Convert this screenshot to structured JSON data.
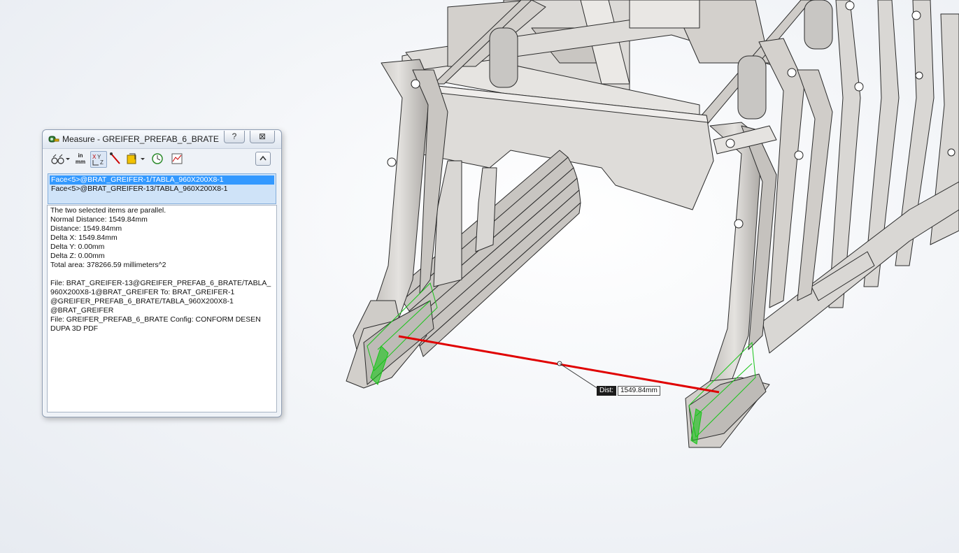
{
  "dialog": {
    "title": "Measure - GREIFER_PREFAB_6_BRATE",
    "help_label": "?",
    "close_label": "⊠",
    "toolbar": {
      "units_in": "in",
      "units_mm": "mm",
      "icons": [
        "arc-circle-options-icon",
        "units-precision-icon",
        "xyz-measure-icon",
        "point-to-point-icon",
        "projection-on-icon",
        "measure-history-icon",
        "create-sensor-icon",
        "collapse-icon"
      ]
    },
    "selections": [
      "Face<5>@BRAT_GREIFER-1/TABLA_960X200X8-1",
      "Face<5>@BRAT_GREIFER-13/TABLA_960X200X8-1"
    ],
    "results": [
      "The two selected items are parallel.",
      "Normal Distance: 1549.84mm",
      "Distance: 1549.84mm",
      "Delta X: 1549.84mm",
      "Delta Y: 0.00mm",
      "Delta Z: 0.00mm",
      "Total area: 378266.59 millimeters^2"
    ],
    "files": [
      "File: BRAT_GREIFER-13@GREIFER_PREFAB_6_BRATE/TABLA_",
      "960X200X8-1@BRAT_GREIFER To: BRAT_GREIFER-1",
      "@GREIFER_PREFAB_6_BRATE/TABLA_960X200X8-1",
      "@BRAT_GREIFER",
      "File: GREIFER_PREFAB_6_BRATE Config: CONFORM DESEN",
      "DUPA 3D PDF"
    ]
  },
  "viewport": {
    "dist_label": "Dist:",
    "dist_value": "1549.84mm",
    "measure_line_color": "#e00000",
    "model_color": "#d7d5d2",
    "selection_color": "#18c418"
  }
}
